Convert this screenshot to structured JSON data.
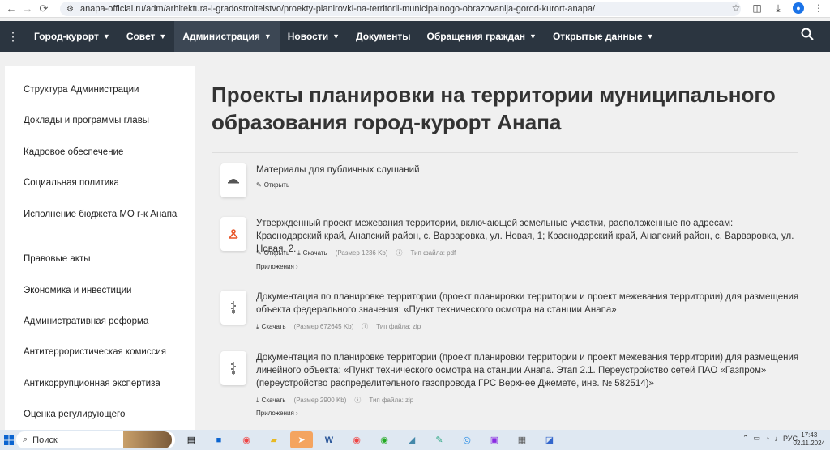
{
  "browser": {
    "url": "anapa-official.ru/adm/arhitektura-i-gradostroitelstvo/proekty-planirovki-na-territorii-municipalnogo-obrazovanija-gorod-kurort-anapa/"
  },
  "nav": {
    "items": [
      {
        "label": "Город-курорт",
        "caret": true
      },
      {
        "label": "Совет",
        "caret": true
      },
      {
        "label": "Администрация",
        "caret": true,
        "active": true
      },
      {
        "label": "Новости",
        "caret": true
      },
      {
        "label": "Документы",
        "caret": false
      },
      {
        "label": "Обращения граждан",
        "caret": true
      },
      {
        "label": "Открытые данные",
        "caret": true
      }
    ]
  },
  "sidebar": {
    "items": [
      "Структура Администрации",
      "Доклады и программы главы",
      "Кадровое обеспечение",
      "Социальная политика",
      "Исполнение бюджета МО г-к Анапа",
      "Правовые акты",
      "Экономика и инвестиции",
      "Административная реформа",
      "Антитеррористическая комиссия",
      "Антикоррупционная экспертиза",
      "Оценка регулирующего"
    ]
  },
  "page": {
    "title": "Проекты планировки на территории муниципального образования город-курорт Анапа"
  },
  "docs": [
    {
      "icon": "folder-icon",
      "title": "Материалы для публичных слушаний",
      "open": "Открыть"
    },
    {
      "icon": "pdf-icon",
      "title": "Утвержденный проект межевания территории, включающей земельные участки, расположенные по адресам: Краснодарский край, Анапский район, с. Варваровка, ул. Новая, 1; Краснодарский край, Анапский район, с. Варваровка, ул. Новая, 2.",
      "open": "Открыть",
      "download": "Скачать",
      "size": "(Размер 1236 Kb)",
      "type": "Тип файла: pdf",
      "attachments": "Приложения"
    },
    {
      "icon": "zip-icon",
      "title": "Документация по планировке территории (проект планировки территории и проект межевания территории) для размещения объекта федерального значения: «Пункт технического осмотра на станции Анапа»",
      "download": "Скачать",
      "size": "(Размер 672645 Kb)",
      "type": "Тип файла: zip"
    },
    {
      "icon": "zip-icon",
      "title": "Документация по планировке территории (проект планировки территории и проект межевания территории) для размещения линейного объекта: «Пункт технического осмотра на станции Анапа. Этап 2.1. Переустройство сетей ПАО «Газпром» (переустройство распределительного газопровода ГРС Верхнее Джемете, инв. № 582514)»",
      "download": "Скачать",
      "size": "(Размер 2900 Kb)",
      "type": "Тип файла: zip",
      "attachments": "Приложения"
    }
  ],
  "taskbar": {
    "search": "Поиск",
    "lang": "РУС",
    "time": "17:43",
    "date": "02.11.2024"
  }
}
